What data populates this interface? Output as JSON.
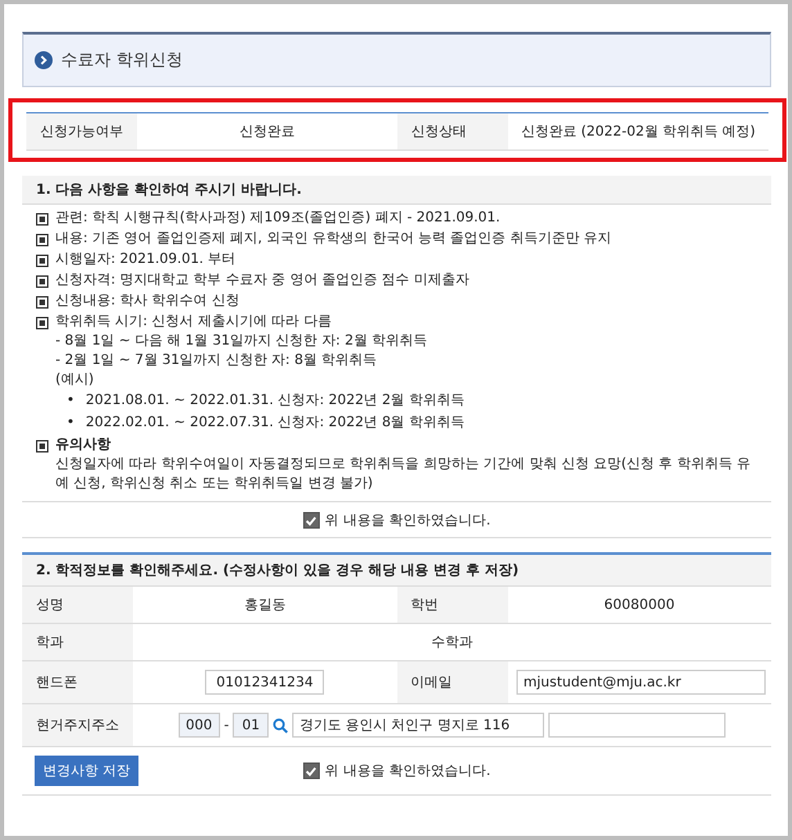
{
  "page_title": "수료자 학위신청",
  "status_table": {
    "highlighted": true,
    "cells": [
      {
        "label": "신청가능여부",
        "value": "신청완료"
      },
      {
        "label": "신청상태",
        "value": "신청완료 (2022-02월 학위취득 예정)"
      }
    ]
  },
  "notice": {
    "heading": "1. 다음 사항을 확인하여 주시기 바랍니다.",
    "items": [
      {
        "kind": "line",
        "text": "관련: 학칙 시행규칙(학사과정) 제109조(졸업인증) 폐지 - 2021.09.01."
      },
      {
        "kind": "line",
        "text": "내용: 기존 영어 졸업인증제 폐지, 외국인 유학생의 한국어 능력 졸업인증 취득기준만 유지"
      },
      {
        "kind": "line",
        "text": "시행일자: 2021.09.01. 부터"
      },
      {
        "kind": "line",
        "text": "신청자격: 명지대학교 학부 수료자 중 영어 졸업인증 점수 미제출자"
      },
      {
        "kind": "line",
        "text": "신청내용: 학사 학위수여 신청"
      },
      {
        "kind": "schedule",
        "text": "학위취득 시기: 신청서 제출시기에 따라 다름",
        "sublines": [
          "- 8월 1일 ~ 다음 해 1월 31일까지 신청한 자: 2월 학위취득",
          "- 2월 1일 ~ 7월 31일까지 신청한 자: 8월 학위취득",
          "(예시)"
        ],
        "marker": "•",
        "examples": [
          "2021.08.01. ~ 2022.01.31. 신청자: 2022년 2월 학위취득",
          "2022.02.01. ~ 2022.07.31. 신청자: 2022년 8월 학위취득"
        ]
      },
      {
        "kind": "caution",
        "text": "유의사항",
        "detail": "신청일자에 따라 학위수여일이 자동결정되므로 학위취득을 희망하는 기간에 맞춰 신청 요망(신청 후 학위취득 유예 신청, 학위신청 취소 또는 학위취득일 변경 불가)"
      }
    ],
    "confirm": {
      "label": "위 내용을 확인하였습니다.",
      "checked": true
    }
  },
  "student_info": {
    "heading": "2. 학적정보를 확인해주세요. (수정사항이 있을 경우 해당 내용 변경 후 저장)",
    "name": {
      "label": "성명",
      "value": "홍길동"
    },
    "student_id": {
      "label": "학번",
      "value": "60080000"
    },
    "department": {
      "label": "학과",
      "value": "수학과"
    },
    "phone": {
      "label": "핸드폰",
      "value": "01012341234"
    },
    "email": {
      "label": "이메일",
      "value": "mjustudent@mju.ac.kr"
    },
    "address": {
      "label": "현거주지주소",
      "zip_1": "000",
      "zip_separator": "-",
      "zip_2": "01",
      "line_1": "경기도 용인시 처인구 명지로 116"
    },
    "save_button": "변경사항 저장",
    "confirm": {
      "label": "위 내용을 확인하였습니다.",
      "checked": true
    }
  }
}
